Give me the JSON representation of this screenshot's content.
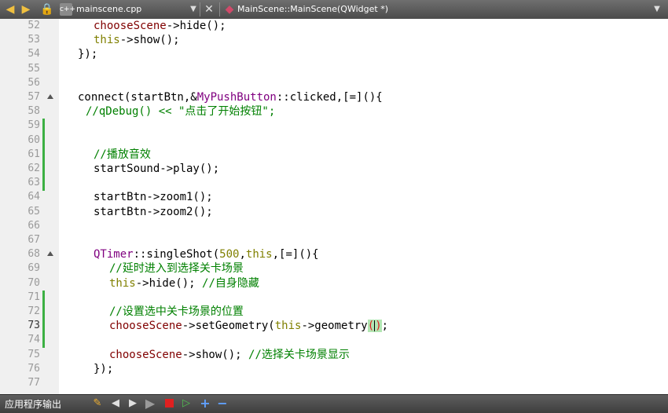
{
  "toolbar": {
    "file_tab": "mainscene.cpp",
    "function_selector": "MainScene::MainScene(QWidget *)"
  },
  "editor": {
    "current_line": 73,
    "lines": [
      {
        "n": "52",
        "fold": false,
        "mod": false,
        "indent": 4,
        "tokens": [
          {
            "t": "chooseScene",
            "c": "mt"
          },
          {
            "t": "->hide();",
            "c": "fn"
          }
        ]
      },
      {
        "n": "53",
        "fold": false,
        "mod": false,
        "indent": 4,
        "tokens": [
          {
            "t": "this",
            "c": "kw"
          },
          {
            "t": "->show();",
            "c": "fn"
          }
        ]
      },
      {
        "n": "54",
        "fold": false,
        "mod": false,
        "indent": 2,
        "tokens": [
          {
            "t": "});",
            "c": "fn"
          }
        ]
      },
      {
        "n": "55",
        "fold": false,
        "mod": false,
        "indent": 0,
        "tokens": []
      },
      {
        "n": "56",
        "fold": false,
        "mod": false,
        "indent": 0,
        "tokens": []
      },
      {
        "n": "57",
        "fold": true,
        "mod": false,
        "indent": 2,
        "tokens": [
          {
            "t": "connect(startBtn,&",
            "c": "fn"
          },
          {
            "t": "MyPushButton",
            "c": "ty"
          },
          {
            "t": "::clicked,[=](){",
            "c": "fn"
          }
        ]
      },
      {
        "n": "58",
        "fold": false,
        "mod": false,
        "indent": 3,
        "tokens": [
          {
            "t": "//qDebug() << \"点击了开始按钮\";",
            "c": "cm"
          }
        ]
      },
      {
        "n": "59",
        "fold": false,
        "mod": true,
        "indent": 0,
        "tokens": []
      },
      {
        "n": "60",
        "fold": false,
        "mod": true,
        "indent": 0,
        "tokens": []
      },
      {
        "n": "61",
        "fold": false,
        "mod": true,
        "indent": 4,
        "tokens": [
          {
            "t": "//播放音效",
            "c": "cm"
          }
        ]
      },
      {
        "n": "62",
        "fold": false,
        "mod": true,
        "indent": 4,
        "tokens": [
          {
            "t": "startSound->play();",
            "c": "fn"
          }
        ]
      },
      {
        "n": "63",
        "fold": false,
        "mod": true,
        "indent": 0,
        "tokens": []
      },
      {
        "n": "64",
        "fold": false,
        "mod": false,
        "indent": 4,
        "tokens": [
          {
            "t": "startBtn->zoom1();",
            "c": "fn"
          }
        ]
      },
      {
        "n": "65",
        "fold": false,
        "mod": false,
        "indent": 4,
        "tokens": [
          {
            "t": "startBtn->zoom2();",
            "c": "fn"
          }
        ]
      },
      {
        "n": "66",
        "fold": false,
        "mod": false,
        "indent": 0,
        "tokens": []
      },
      {
        "n": "67",
        "fold": false,
        "mod": false,
        "indent": 0,
        "tokens": []
      },
      {
        "n": "68",
        "fold": true,
        "mod": false,
        "indent": 4,
        "tokens": [
          {
            "t": "QTimer",
            "c": "ty"
          },
          {
            "t": "::singleShot(",
            "c": "fn"
          },
          {
            "t": "500",
            "c": "kw"
          },
          {
            "t": ",",
            "c": "fn"
          },
          {
            "t": "this",
            "c": "kw"
          },
          {
            "t": ",[=](){",
            "c": "fn"
          }
        ]
      },
      {
        "n": "69",
        "fold": false,
        "mod": false,
        "indent": 6,
        "tokens": [
          {
            "t": "//延时进入到选择关卡场景",
            "c": "cm"
          }
        ]
      },
      {
        "n": "70",
        "fold": false,
        "mod": false,
        "indent": 6,
        "tokens": [
          {
            "t": "this",
            "c": "kw"
          },
          {
            "t": "->hide(); ",
            "c": "fn"
          },
          {
            "t": "//自身隐藏",
            "c": "cm"
          }
        ]
      },
      {
        "n": "71",
        "fold": false,
        "mod": true,
        "indent": 0,
        "tokens": []
      },
      {
        "n": "72",
        "fold": false,
        "mod": true,
        "indent": 6,
        "tokens": [
          {
            "t": "//设置选中关卡场景的位置",
            "c": "cm"
          }
        ]
      },
      {
        "n": "73",
        "fold": false,
        "mod": true,
        "indent": 6,
        "tokens": [
          {
            "t": "chooseScene",
            "c": "mt"
          },
          {
            "t": "->setGeometry(",
            "c": "fn"
          },
          {
            "t": "this",
            "c": "kw"
          },
          {
            "t": "->geometry",
            "c": "fn"
          },
          {
            "t": "()",
            "c": "hl"
          },
          {
            "t": ";",
            "c": "fn"
          }
        ]
      },
      {
        "n": "74",
        "fold": false,
        "mod": true,
        "indent": 0,
        "tokens": []
      },
      {
        "n": "75",
        "fold": false,
        "mod": false,
        "indent": 6,
        "tokens": [
          {
            "t": "chooseScene",
            "c": "mt"
          },
          {
            "t": "->show(); ",
            "c": "fn"
          },
          {
            "t": "//选择关卡场景显示",
            "c": "cm"
          }
        ]
      },
      {
        "n": "76",
        "fold": false,
        "mod": false,
        "indent": 4,
        "tokens": [
          {
            "t": "});",
            "c": "fn"
          }
        ]
      },
      {
        "n": "77",
        "fold": false,
        "mod": false,
        "indent": 0,
        "tokens": []
      }
    ]
  },
  "statusbar": {
    "panel_title": "应用程序输出"
  }
}
